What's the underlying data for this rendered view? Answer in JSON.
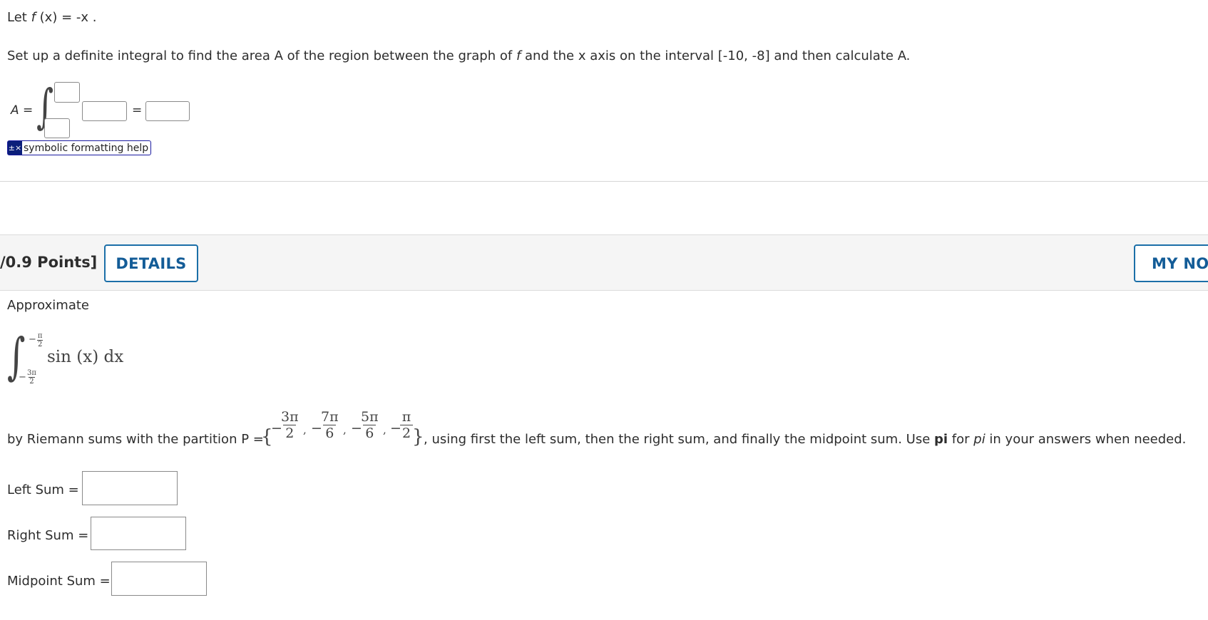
{
  "q1": {
    "line1": {
      "prefix": "Let ",
      "f": "f",
      "rest": " (x) = -x ."
    },
    "line2": {
      "before": "Set up a definite integral to find the area A of the region between the graph of ",
      "f": "f",
      "after": " and the x axis on the interval [-10, -8] and then calculate A."
    },
    "a_label": "A =",
    "integral_sign": "∫",
    "equals": "=",
    "help_label": "symbolic formatting help",
    "help_icon": "plus-minus-times-icon"
  },
  "q2": {
    "points_label": "/0.9 Points]",
    "details_label": "DETAILS",
    "my_notes_label": "MY NOT",
    "approximate": "Approximate",
    "integral": {
      "sign": "∫",
      "upper": {
        "sign": "−",
        "num": "π",
        "den": "2"
      },
      "lower": {
        "sign": "−",
        "num": "3π",
        "den": "2"
      },
      "integrand": "sin (x) dx"
    },
    "riemann": {
      "prefix": "by Riemann sums with the partition P =",
      "open_brace": "{",
      "close_brace": "}",
      "partition": [
        {
          "sign": "−",
          "num": "3π",
          "den": "2"
        },
        {
          "sign": "−",
          "num": "7π",
          "den": "6"
        },
        {
          "sign": "−",
          "num": "5π",
          "den": "6"
        },
        {
          "sign": "−",
          "num": "π",
          "den": "2"
        }
      ],
      "comma": ",",
      "suffix_a": ", using first the left sum, then the right sum, and finally the midpoint sum. Use ",
      "bold_pi": "pi",
      "suffix_b": " for ",
      "italic_pi": "pi",
      "suffix_c": " in your answers when needed."
    },
    "left_sum_label": "Left Sum =",
    "right_sum_label": "Right Sum =",
    "midpoint_sum_label": "Midpoint Sum ="
  }
}
